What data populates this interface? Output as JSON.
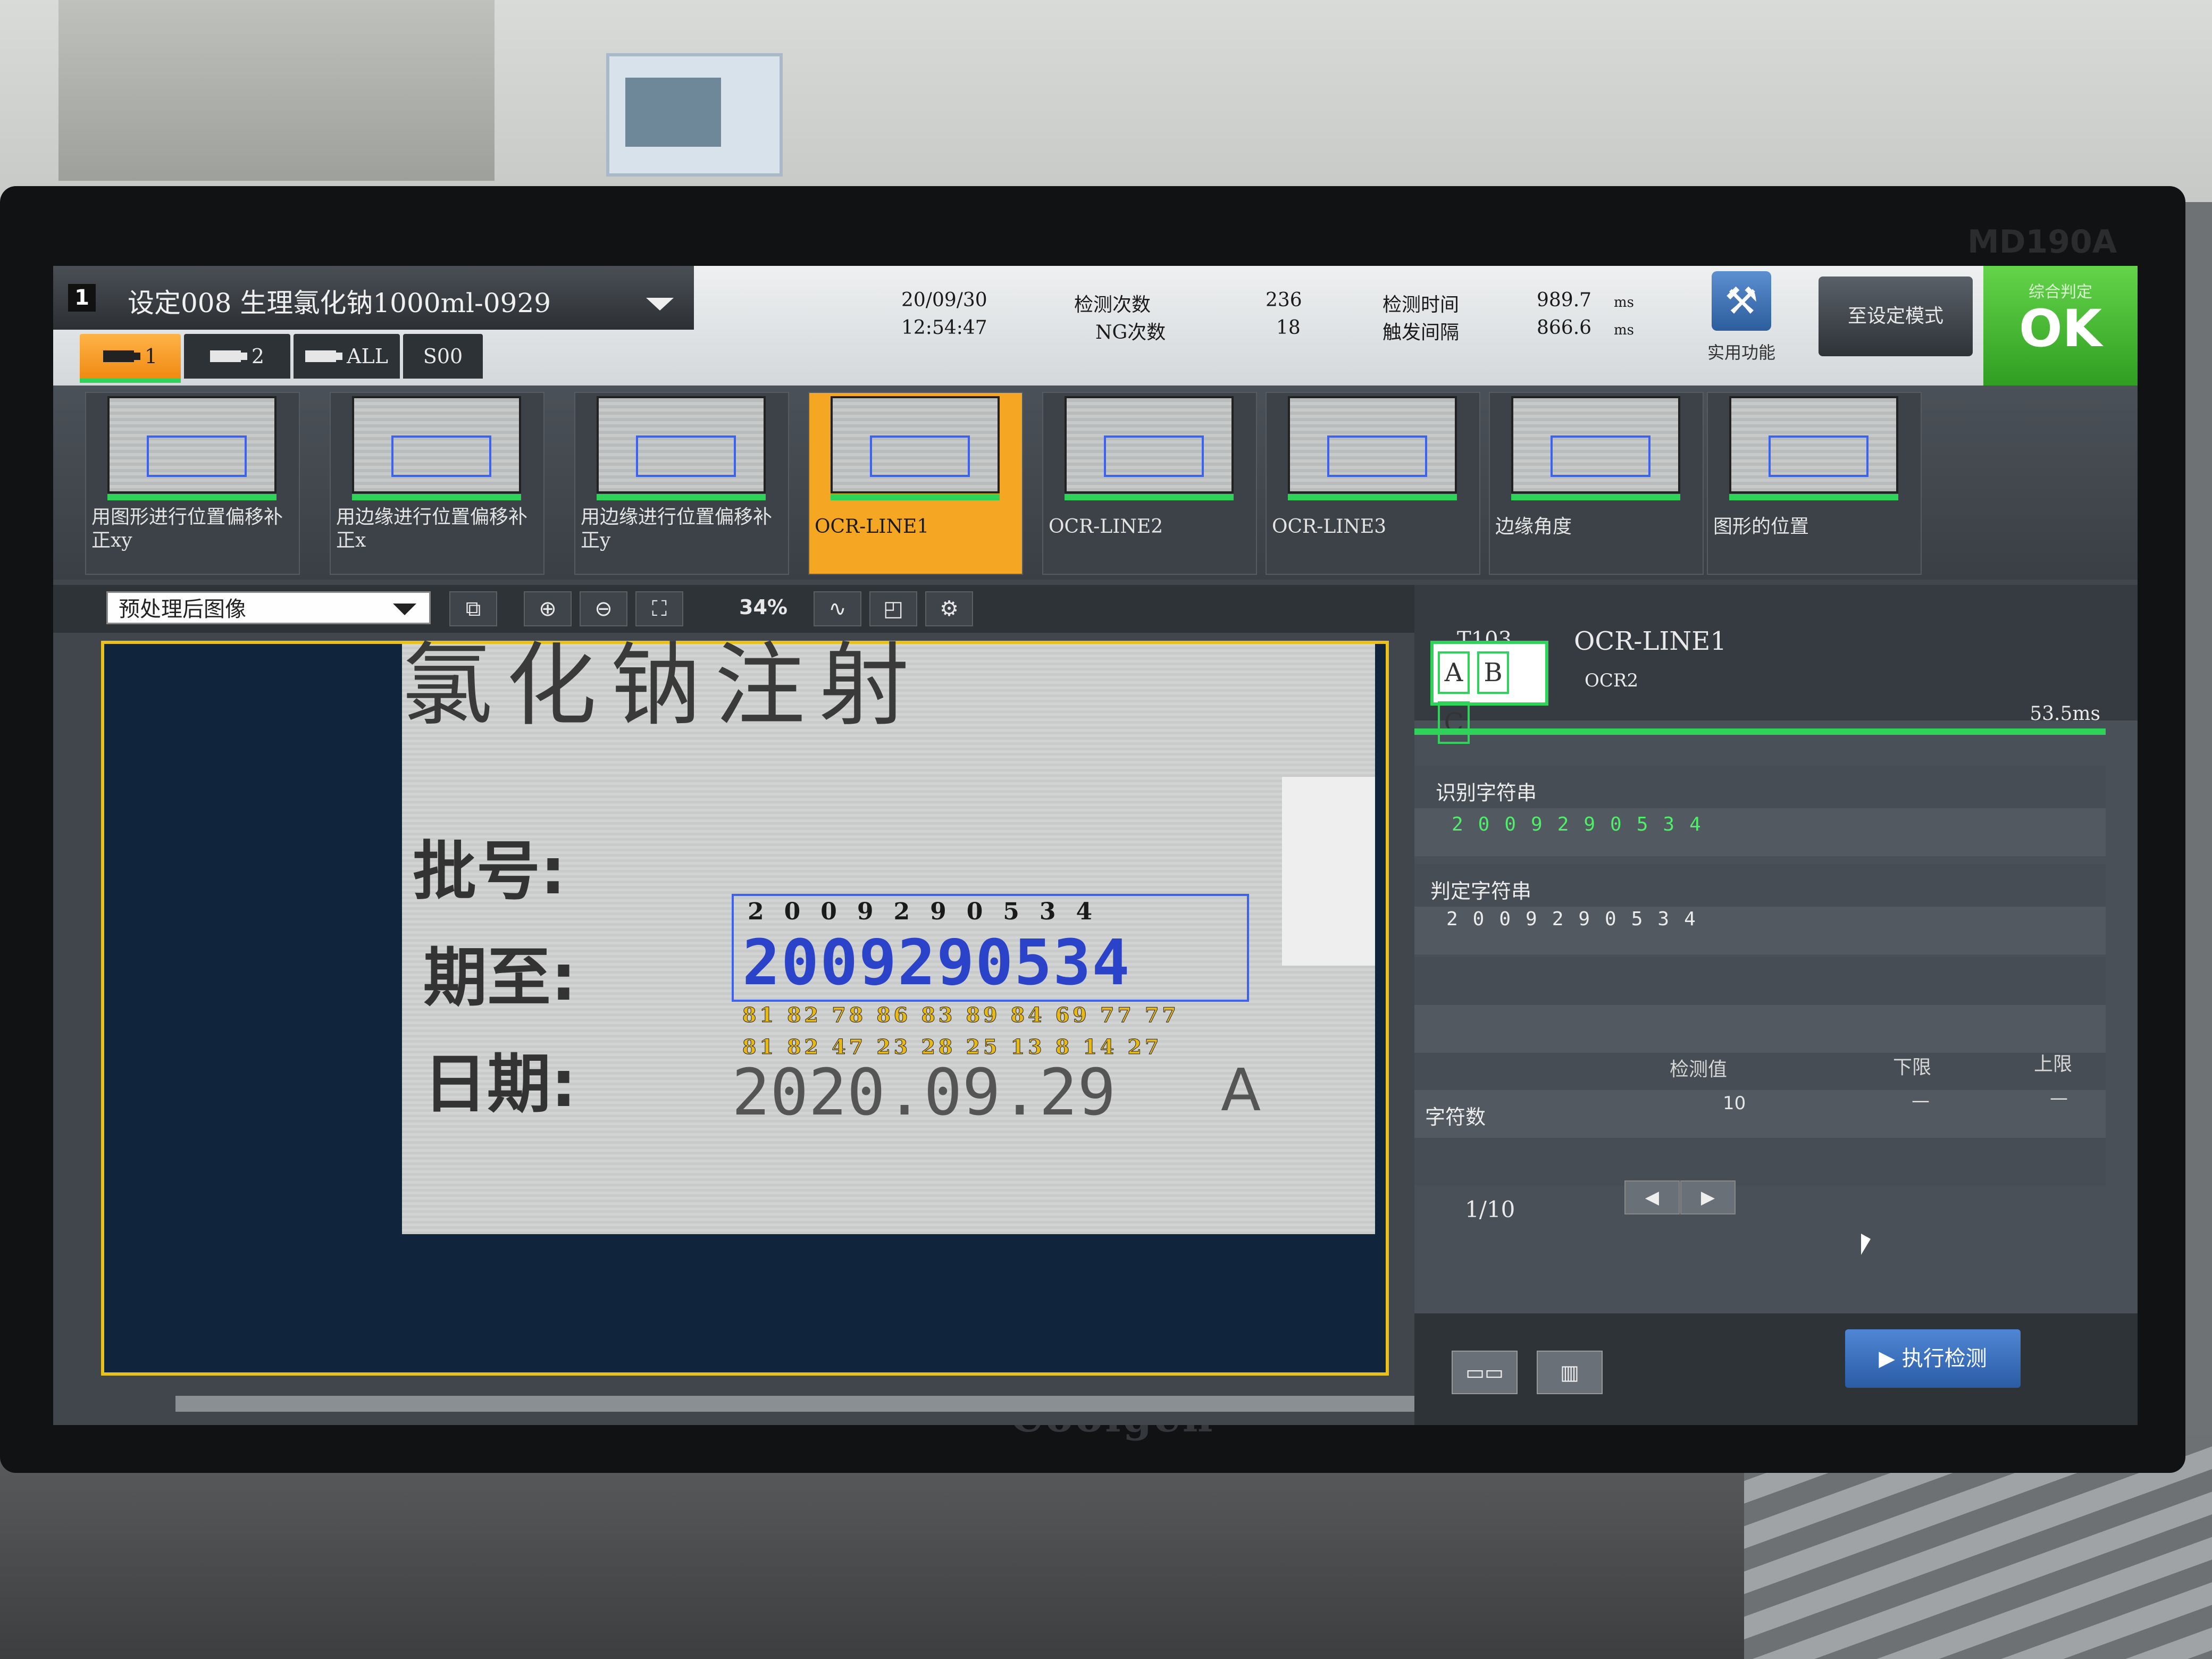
{
  "brand": "Coolgen",
  "model": "MD190A",
  "header": {
    "setting_number": "1",
    "setting_name": "设定008 生理氯化钠1000ml-0929",
    "camera_tabs": [
      {
        "label": "1",
        "active": true
      },
      {
        "label": "2",
        "active": false
      },
      {
        "label": "ALL",
        "active": false
      },
      {
        "label": "S00",
        "active": false
      }
    ],
    "date": "20/09/30",
    "time": "12:54:47",
    "inspect_count_label": "检测次数",
    "inspect_count": "236",
    "ng_count_label": "NG次数",
    "ng_count": "18",
    "inspect_time_label": "检测时间",
    "inspect_time": "989.7",
    "trigger_interval_label": "触发间隔",
    "trigger_interval": "866.6",
    "unit": "ms",
    "utility_label": "实用功能",
    "settings_mode_label": "至设定模式",
    "overall_label": "综合判定",
    "overall_result": "OK"
  },
  "thumbnails": [
    {
      "caption": "用图形进行位置偏移补正xy",
      "active": false
    },
    {
      "caption": "用边缘进行位置偏移补正x",
      "active": false
    },
    {
      "caption": "用边缘进行位置偏移补正y",
      "active": false
    },
    {
      "caption": "OCR-LINE1",
      "active": true
    },
    {
      "caption": "OCR-LINE2",
      "active": false
    },
    {
      "caption": "OCR-LINE3",
      "active": false
    },
    {
      "caption": "边缘角度",
      "active": false
    },
    {
      "caption": "图形的位置",
      "active": false
    }
  ],
  "viewer": {
    "image_mode": "预处理后图像",
    "zoom": "34%",
    "doc_header": "氯化钠注射",
    "label_batch": "批号:",
    "label_expiry": "期至:",
    "label_date": "日期:",
    "ocr_digits_top": "2009290534",
    "ocr_digits_big": "2009290534",
    "ocr_scores_1": "81 82 78 86 83 89 84 69 77 77",
    "ocr_scores_2": "81 82 47 23 28 25 13 8 14 27",
    "doc_date": "2020.09.29",
    "doc_letter": "A"
  },
  "panel": {
    "tool_id": "T103",
    "tool_name": "OCR-LINE1",
    "tool_type": "OCR2",
    "tool_time": "53.5ms",
    "recognized_label": "识别字符串",
    "recognized_value": "2009290534",
    "judge_label": "判定字符串",
    "judge_value": "2009290534",
    "col_measured": "检测值",
    "col_lower": "下限",
    "col_upper": "上限",
    "row_label": "字符数",
    "row_measured": "10",
    "row_lower": "—",
    "row_upper": "—",
    "pager": "1/10",
    "execute_label": "执行检测"
  },
  "colors": {
    "ok_green": "#2f9e22",
    "active_orange": "#f5a623",
    "roi_blue": "#3b62f0",
    "highlight_green": "#2fd35a"
  }
}
